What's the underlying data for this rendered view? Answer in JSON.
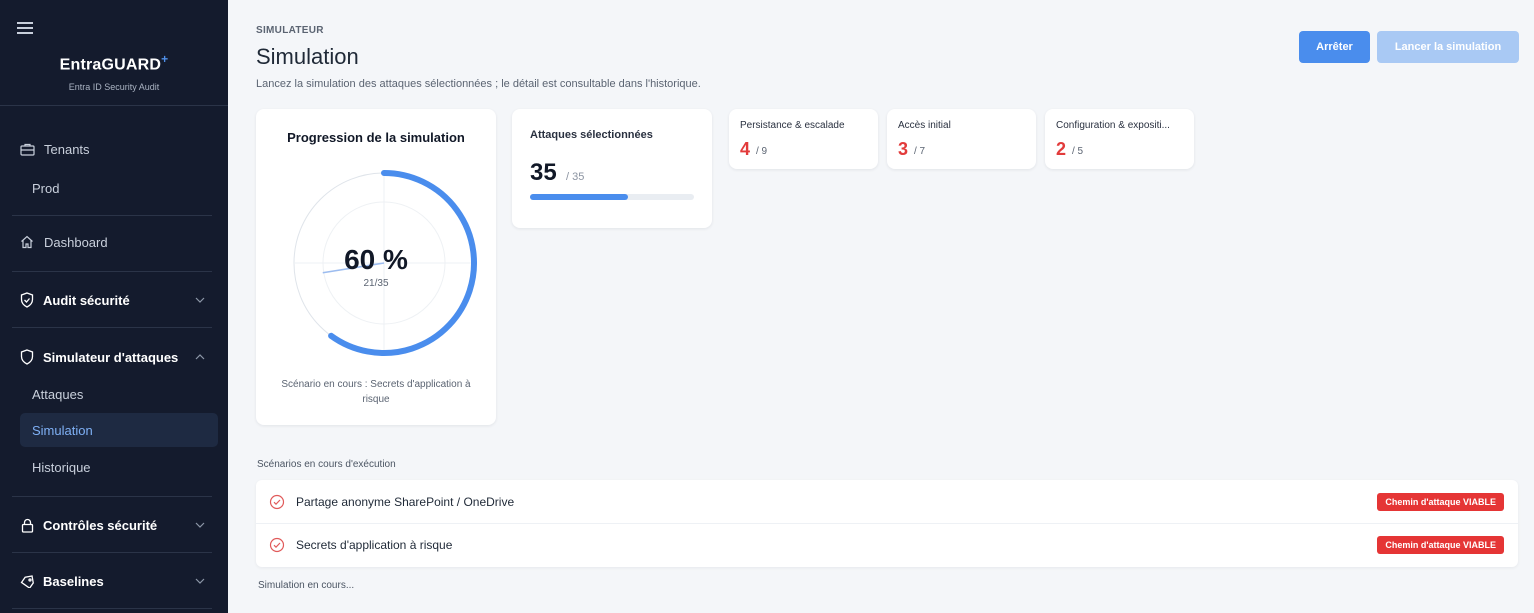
{
  "sidebar": {
    "brand": {
      "name": "EntraGUARD",
      "plus": "+",
      "subtitle": "Entra ID Security Audit"
    },
    "items": {
      "tenants": "Tenants",
      "prod": "Prod",
      "dashboard": "Dashboard",
      "audit": "Audit sécurité",
      "simulator": "Simulateur d'attaques",
      "attacks": "Attaques",
      "simulation": "Simulation",
      "history": "Historique",
      "controls": "Contrôles sécurité",
      "baselines": "Baselines"
    }
  },
  "header": {
    "eyebrow": "SIMULATEUR",
    "title": "Simulation",
    "description": "Lancez la simulation des attaques sélectionnées ; le détail est consultable dans l'historique.",
    "stop_label": "Arrêter",
    "launch_label": "Lancer la simulation"
  },
  "progress": {
    "title": "Progression de la simulation",
    "percent_label": "60 %",
    "percent_value": 60,
    "count": "21/35",
    "current_scenario": "Scénario en cours : Secrets d'application à risque"
  },
  "selected": {
    "label": "Attaques sélectionnées",
    "value": "35",
    "total": "/ 35",
    "progress_fraction": 0.6
  },
  "categories": [
    {
      "label": "Persistance & escalade",
      "value": "4",
      "total": "/ 9"
    },
    {
      "label": "Accès initial",
      "value": "3",
      "total": "/ 7"
    },
    {
      "label": "Configuration & expositi...",
      "value": "2",
      "total": "/ 5"
    }
  ],
  "scenarios": {
    "title": "Scénarios en cours d'exécution",
    "rows": [
      {
        "name": "Partage anonyme SharePoint / OneDrive",
        "badge": "Chemin d'attaque VIABLE"
      },
      {
        "name": "Secrets d'application à risque",
        "badge": "Chemin d'attaque VIABLE"
      }
    ]
  },
  "status": "Simulation en cours...",
  "colors": {
    "accent": "#4a8ded",
    "danger": "#e53535",
    "sidebar": "#141b2d"
  }
}
